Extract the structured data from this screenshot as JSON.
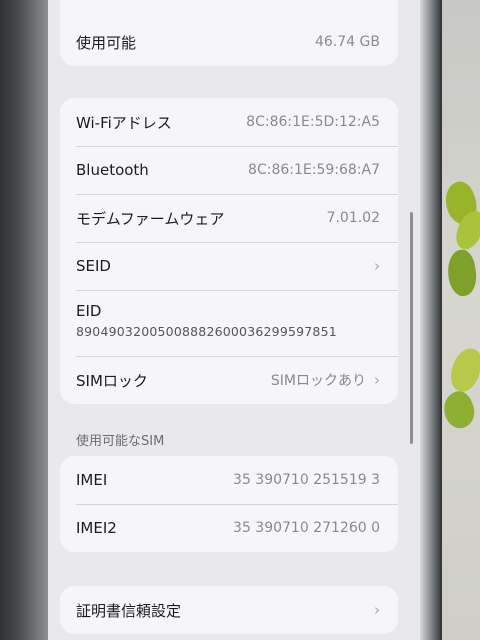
{
  "storage": {
    "label": "使用可能",
    "value": "46.74 GB"
  },
  "network": {
    "rows": [
      {
        "label": "Wi-Fiアドレス",
        "value": "8C:86:1E:5D:12:A5"
      },
      {
        "label": "Bluetooth",
        "value": "8C:86:1E:59:68:A7"
      },
      {
        "label": "モデムファームウェア",
        "value": "7.01.02"
      },
      {
        "label": "SEID"
      },
      {
        "label": "EID",
        "value": "89049032005008882600036299597851"
      },
      {
        "label": "SIMロック",
        "value": "SIMロックあり"
      }
    ]
  },
  "sim_section": {
    "title": "使用可能なSIM",
    "rows": [
      {
        "label": "IMEI",
        "value": "35 390710 251519 3"
      },
      {
        "label": "IMEI2",
        "value": "35 390710 271260 0"
      }
    ]
  },
  "certificates": {
    "label": "証明書信頼設定"
  },
  "icons": {
    "chevron": "chevron-right-icon"
  }
}
